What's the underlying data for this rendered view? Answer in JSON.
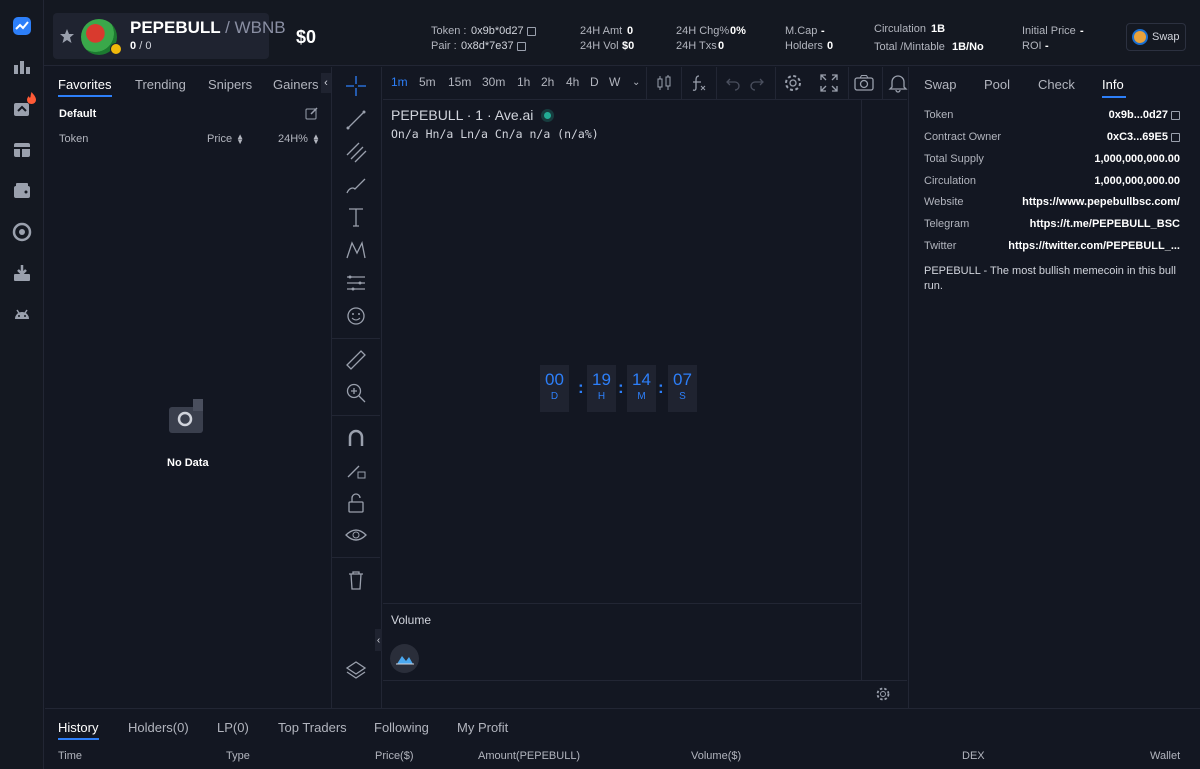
{
  "token": {
    "symbol": "PEPEBULL",
    "quote": "/ WBNB",
    "count_a": "0",
    "count_sep": "/",
    "count_b": "0",
    "price": "$0"
  },
  "stats": {
    "token_label": "Token :",
    "token_value": "0x9b*0d27",
    "pair_label": "Pair :",
    "pair_value": "0x8d*7e37",
    "amt_label": "24H Amt",
    "amt_value": "0",
    "vol_label": "24H Vol",
    "vol_value": "$0",
    "chg_label": "24H Chg%",
    "chg_value": "0%",
    "txs_label": "24H Txs",
    "txs_value": "0",
    "mcap_label": "M.Cap",
    "mcap_value": "-",
    "holders_label": "Holders",
    "holders_value": "0",
    "circ_label": "Circulation",
    "circ_value": "1B",
    "total_label": "Total /Mintable",
    "total_value": "1B/No",
    "initial_label": "Initial Price",
    "initial_value": "-",
    "roi_label": "ROI",
    "roi_value": "-",
    "swap_label": "Swap"
  },
  "favorites": {
    "tabs": [
      "Favorites",
      "Trending",
      "Snipers",
      "Gainers"
    ],
    "group": "Default",
    "col_token": "Token",
    "col_price": "Price",
    "col_24h": "24H%",
    "empty": "No Data"
  },
  "chart": {
    "timeframes": [
      "1m",
      "5m",
      "15m",
      "30m",
      "1h",
      "2h",
      "4h",
      "D",
      "W"
    ],
    "legend_title": "PEPEBULL · 1 · Ave.ai",
    "ohlc": "On/a Hn/a Ln/a Cn/a n/a (n/a%)",
    "volume_label": "Volume",
    "countdown": [
      {
        "num": "00",
        "unit": "D"
      },
      {
        "num": "19",
        "unit": "H"
      },
      {
        "num": "14",
        "unit": "M"
      },
      {
        "num": "07",
        "unit": "S"
      }
    ]
  },
  "info": {
    "tabs": [
      "Swap",
      "Pool",
      "Check",
      "Info"
    ],
    "rows": [
      {
        "k": "Token",
        "v": "0x9b...0d27"
      },
      {
        "k": "Contract Owner",
        "v": "0xC3...69E5"
      },
      {
        "k": "Total Supply",
        "v": "1,000,000,000.00"
      },
      {
        "k": "Circulation",
        "v": "1,000,000,000.00"
      },
      {
        "k": "Website",
        "v": "https://www.pepebullbsc.com/"
      },
      {
        "k": "Telegram",
        "v": "https://t.me/PEPEBULL_BSC"
      },
      {
        "k": "Twitter",
        "v": "https://twitter.com/PEPEBULL_..."
      }
    ],
    "description": "PEPEBULL - The most bullish memecoin in this bull run."
  },
  "bottom": {
    "tabs": [
      "History",
      "Holders(0)",
      "LP(0)",
      "Top Traders",
      "Following",
      "My Profit"
    ],
    "columns": [
      "Time",
      "Type",
      "Price($)",
      "Amount(PEPEBULL)",
      "Volume($)",
      "DEX",
      "Wallet"
    ]
  },
  "colors": {
    "background": "#131722",
    "panel": "#141821",
    "accent": "#2d7ff9",
    "border": "#222634"
  }
}
